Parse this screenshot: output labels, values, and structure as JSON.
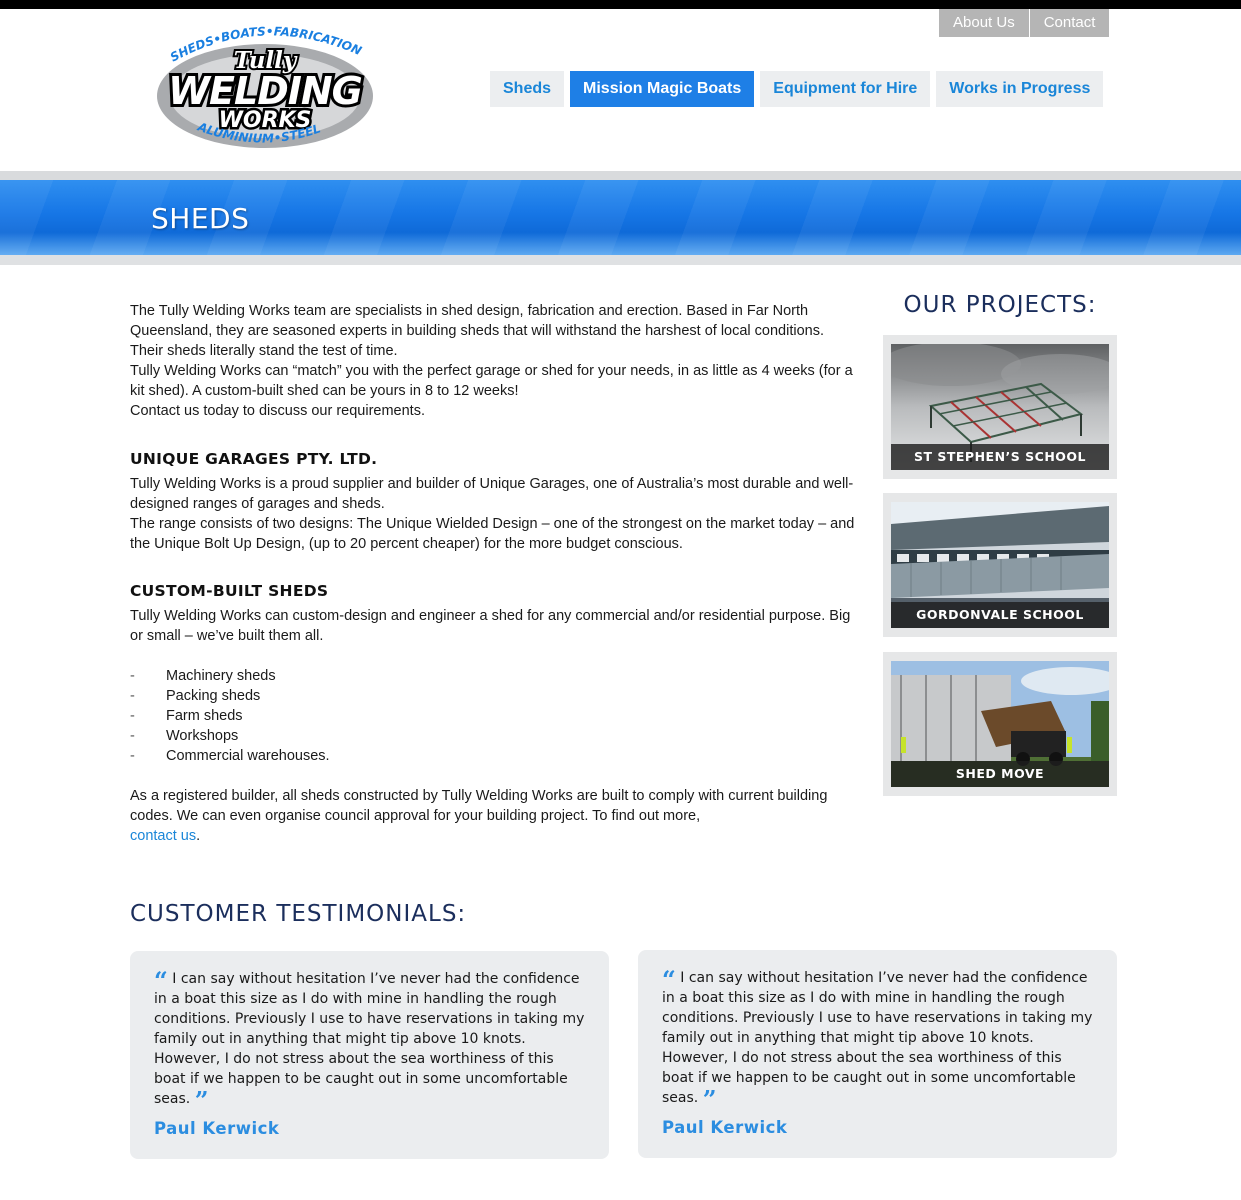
{
  "logo": {
    "text_top": "SHEDS•BOATS•FABRICATION",
    "text_line1": "Tully",
    "text_line2": "WELDING",
    "text_line3": "WORKS",
    "text_bottom": "ALUMINIUM•STEEL"
  },
  "util_nav": [
    "About Us",
    "Contact"
  ],
  "main_nav": [
    {
      "label": "Sheds",
      "active": false
    },
    {
      "label": "Mission Magic Boats",
      "active": true
    },
    {
      "label": "Equipment for Hire",
      "active": false
    },
    {
      "label": "Works in Progress",
      "active": false
    }
  ],
  "banner": {
    "title": "SHEDS"
  },
  "content": {
    "intro": [
      "The Tully Welding Works team are specialists in shed design, fabrication and erection. Based in Far North Queensland, they are seasoned experts in building sheds that will withstand the harshest of local conditions. Their sheds literally stand the test of time.",
      "Tully Welding Works can “match” you with the perfect garage or shed for your needs, in as little as 4 weeks (for a kit shed). A custom-built shed can be yours in 8 to 12 weeks!",
      "Contact us today to discuss our requirements."
    ],
    "unique_heading": "UNIQUE GARAGES PTY. LTD.",
    "unique_paras": [
      "Tully Welding Works is a proud supplier and builder of Unique Garages, one of Australia’s most durable and well-designed ranges of garages and sheds.",
      "The range consists of two designs: The Unique Wielded Design – one of the strongest on the market today – and the Unique Bolt Up Design, (up to 20 percent cheaper) for the more budget conscious."
    ],
    "custom_heading": "CUSTOM-BUILT SHEDS",
    "custom_para": "Tully Welding Works can custom-design and engineer a shed for any commercial and/or residential purpose. Big or small – we’ve built them all.",
    "list_dash": "-",
    "list": [
      "Machinery sheds",
      "Packing sheds",
      "Farm sheds",
      "Workshops",
      "Commercial warehouses."
    ],
    "closing": "As a registered builder, all sheds constructed by Tully Welding Works are built to comply with current building codes. We can even organise council approval for your building project. To find out more,",
    "closing_link": "contact us",
    "closing_end": "."
  },
  "sidebar": {
    "title": "OUR PROJECTS:",
    "projects": [
      {
        "caption": "ST STEPHEN’S SCHOOL"
      },
      {
        "caption": "GORDONVALE SCHOOL"
      },
      {
        "caption": "SHED MOVE"
      }
    ]
  },
  "testimonials": {
    "title": "CUSTOMER TESTIMONIALS:",
    "items": [
      {
        "open_quote": "“",
        "text": "I can say without hesitation I’ve never had the confidence in a boat this size as I do with mine in handling the rough conditions. Previously I use to have reservations in taking my family out in anything that might tip above 10 knots. However, I do not stress about the sea worthiness of this boat if we happen to be caught out in some uncomfortable seas.",
        "close_quote": "”",
        "author": "Paul Kerwick"
      },
      {
        "open_quote": "“",
        "text": "I can say without hesitation I’ve never had the confidence in a boat this size as I do with mine in handling the rough conditions. Previously I use to have reservations in taking my family out in anything that might tip above 10 knots. However, I do not stress about the sea worthiness of this boat if we happen to be caught out in some uncomfortable seas.",
        "close_quote": "”",
        "author": "Paul Kerwick"
      }
    ]
  },
  "colors": {
    "accent_blue": "#1e7fe6",
    "link_blue": "#1a86d8",
    "heading_navy": "#1b2e5c",
    "util_gray": "#b5b5b5"
  }
}
